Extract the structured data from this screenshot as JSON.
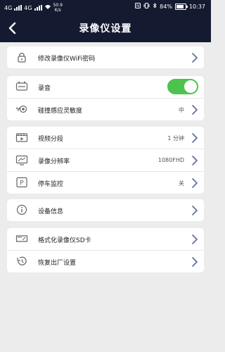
{
  "status_bar": {
    "signal_a": "4G",
    "signal_b": "4G",
    "net_speed": "50.9",
    "net_speed_unit": "K/s",
    "battery": "84%",
    "battery_level": 0.84,
    "time": "10:37"
  },
  "header": {
    "title": "录像仪设置",
    "back_icon": "chevron-left-icon"
  },
  "sections": {
    "wifi": {
      "label": "修改录像仪WiFi密码"
    },
    "audio": {
      "label": "录音",
      "enabled": true,
      "accent": "#4cc34c"
    },
    "collision": {
      "label": "碰撞感应灵敏度",
      "value": "中"
    },
    "segment": {
      "label": "视频分段",
      "value": "1 分钟"
    },
    "resolution": {
      "label": "录像分辨率",
      "value": "1080FHD"
    },
    "parking": {
      "label": "停车监控",
      "value": "关"
    },
    "device_info": {
      "label": "设备信息"
    },
    "format_sd": {
      "label": "格式化录像仪SD卡"
    },
    "factory_reset": {
      "label": "恢复出厂设置"
    }
  },
  "colors": {
    "header_bg": "#141a30",
    "page_bg": "#ececec",
    "chevron": "#5a6a9a"
  }
}
